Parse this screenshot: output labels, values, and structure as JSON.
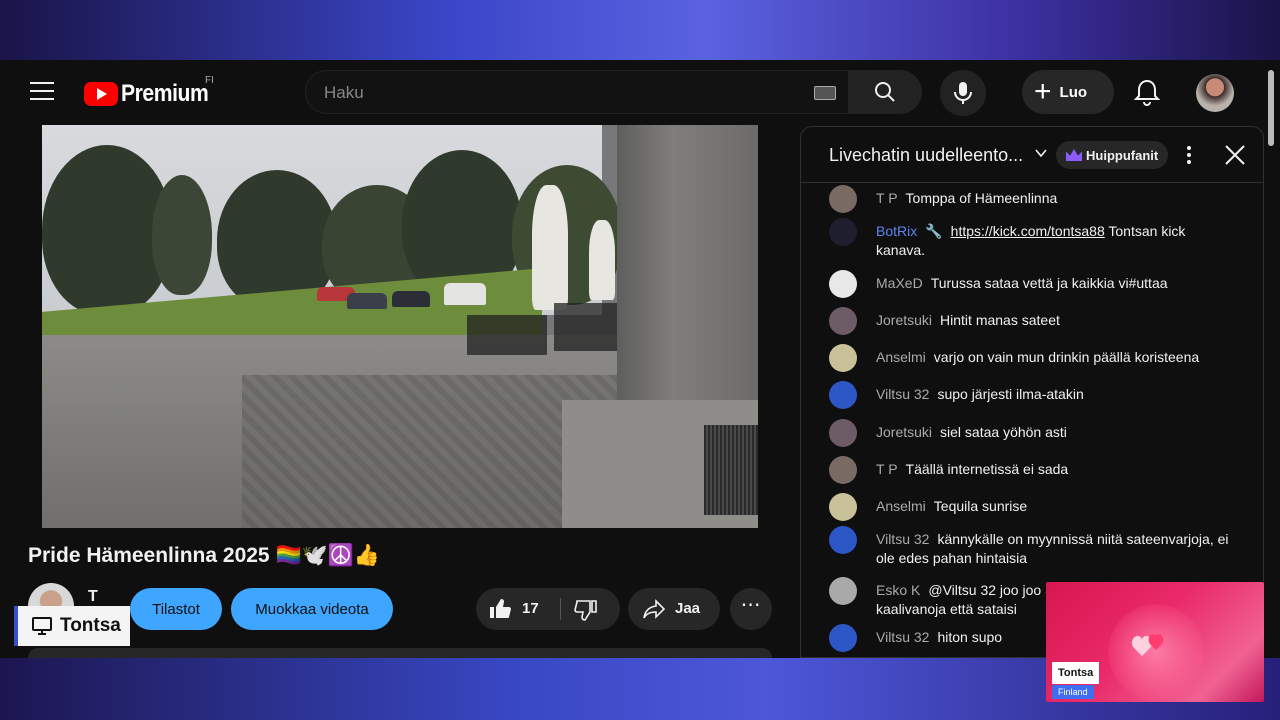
{
  "app": {
    "logo_text": "Premium",
    "country_code": "FI"
  },
  "search": {
    "placeholder": "Haku"
  },
  "header": {
    "create_label": "Luo"
  },
  "video": {
    "title": "Pride Hämeenlinna 2025 🏳️‍🌈🕊️☮️👍",
    "channel_initial": "T",
    "stats_button": "Tilastot",
    "edit_button": "Muokkaa videota",
    "like_count": "17",
    "share_label": "Jaa"
  },
  "chat": {
    "title": "Livechatin uudelleento...",
    "superfans_label": "Huippufanit",
    "messages": [
      {
        "author": "T P",
        "text": "Tomppa of Hämeenlinna"
      },
      {
        "author": "BotRix",
        "text": "Tontsan kick kanava.",
        "link": "https://kick.com/tontsa88"
      },
      {
        "author": "MaXeD",
        "text": "Turussa sataa vettä ja kaikkia vi#uttaa"
      },
      {
        "author": "Joretsuki",
        "text": "Hintit manas sateet"
      },
      {
        "author": "Anselmi",
        "text": "varjo on vain mun drinkin päällä koristeena"
      },
      {
        "author": "Viltsu 32",
        "text": "supo järjesti ilma-atakin"
      },
      {
        "author": "Joretsuki",
        "text": "siel sataa yöhön asti"
      },
      {
        "author": "T P",
        "text": "Täällä internetissä ei sada"
      },
      {
        "author": "Anselmi",
        "text": "Tequila sunrise"
      },
      {
        "author": "Viltsu 32",
        "text": "kännykälle on myynnissä niitä sateenvarjoja, ei ole edes pahan hintaisia"
      },
      {
        "author": "Esko K",
        "text": "@Viltsu 32 joo joo Supo ne käyttää näitä kaalivanoja että sataisi"
      },
      {
        "author": "Viltsu 32",
        "text": "hiton supo"
      }
    ]
  },
  "overlay": {
    "badge_name": "Tontsa",
    "webcam_name": "Tontsa",
    "webcam_location": "Finland"
  },
  "colors": {
    "accent_blue": "#3ea6ff",
    "bot_name": "#5e84f1",
    "youtube_red": "#ff0000",
    "webcam_pink": "#e91e63"
  }
}
